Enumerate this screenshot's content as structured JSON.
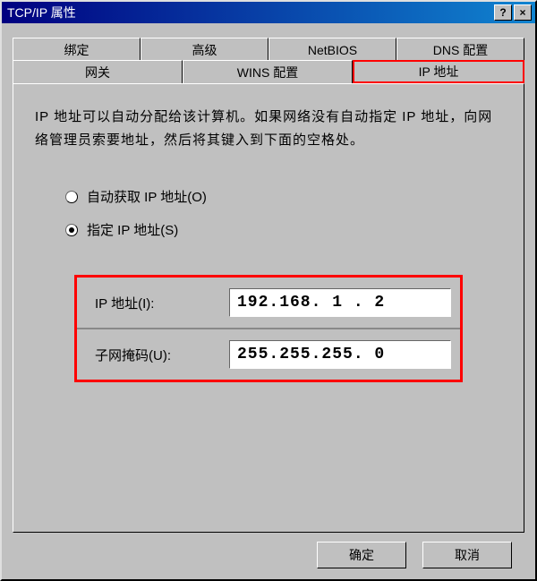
{
  "window": {
    "title": "TCP/IP 属性"
  },
  "tabs": {
    "row1": [
      "绑定",
      "高级",
      "NetBIOS",
      "DNS 配置"
    ],
    "row2": [
      "网关",
      "WINS 配置",
      "IP 地址"
    ]
  },
  "description": "IP 地址可以自动分配给该计算机。如果网络没有自动指定 IP 地址，向网络管理员索要地址，然后将其键入到下面的空格处。",
  "radio": {
    "auto": "自动获取 IP 地址(O)",
    "manual": "指定 IP 地址(S)"
  },
  "fields": {
    "ip_label": "IP 地址(I):",
    "ip_value": "192.168. 1 . 2",
    "mask_label": "子网掩码(U):",
    "mask_value": "255.255.255. 0"
  },
  "buttons": {
    "ok": "确定",
    "cancel": "取消"
  },
  "titlebar_buttons": {
    "help": "?",
    "close": "×"
  }
}
